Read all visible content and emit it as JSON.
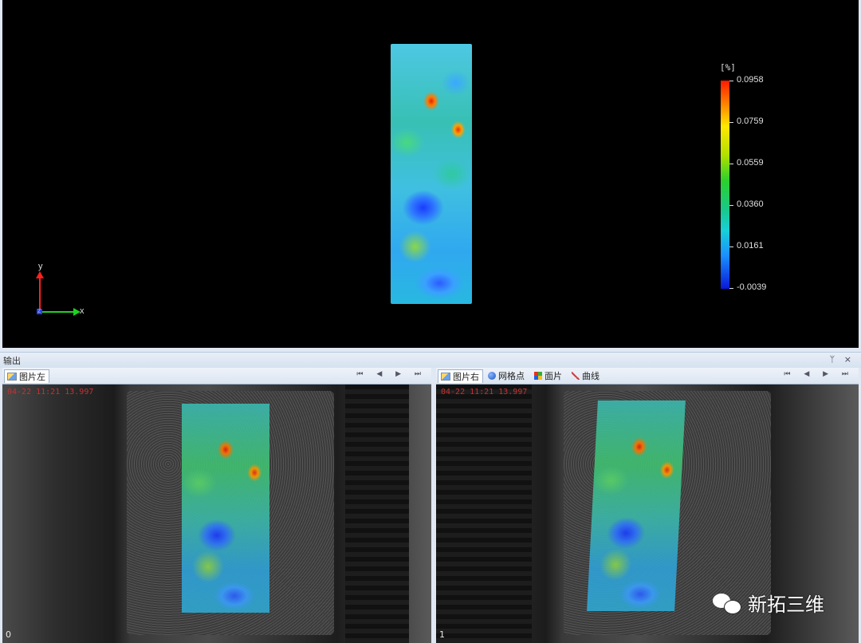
{
  "view3d": {
    "legend": {
      "unit": "[%]",
      "ticks": [
        "0.0958",
        "0.0759",
        "0.0559",
        "0.0360",
        "0.0161",
        "-0.0039"
      ]
    },
    "axes": {
      "y": "y",
      "x": "x",
      "z": "z"
    }
  },
  "output": {
    "title": "输出",
    "controls": "ᛘ ×"
  },
  "left_pane": {
    "tab": "图片左",
    "nav": "⏮ ◀ ▶ ⏭",
    "timestamp": "04-22 11:21 13.997",
    "index": "0"
  },
  "right_pane": {
    "tabs": [
      "图片右",
      "网格点",
      "面片",
      "曲线"
    ],
    "nav": "⏮ ◀ ▶ ⏭",
    "timestamp": "04-22 11:21 13.997",
    "index": "1"
  },
  "watermark": {
    "text": "新拓三维"
  },
  "colors": {
    "accent": "#9fb3cc",
    "timestamp": "#c83030",
    "legend_max": "#ff1a00",
    "legend_min": "#0a18d8"
  }
}
